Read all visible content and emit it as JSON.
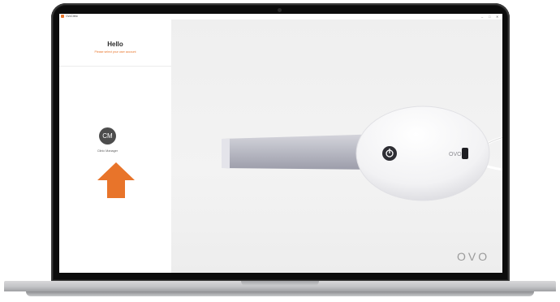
{
  "window": {
    "app_title": "OvoClinic",
    "minimize": "–",
    "maximize": "□",
    "close": "✕"
  },
  "sidebar": {
    "greeting": "Hello",
    "prompt": "Please select your user account",
    "user": {
      "initials": "CM",
      "name": "Clinic Manager"
    }
  },
  "main": {
    "brand": "OVO",
    "device_icon": "intraoral-scanner"
  },
  "colors": {
    "accent": "#e8742a",
    "avatar": "#4d4d4d",
    "sidebar_bg": "#ffffff",
    "main_bg": "#f0f0f0"
  }
}
